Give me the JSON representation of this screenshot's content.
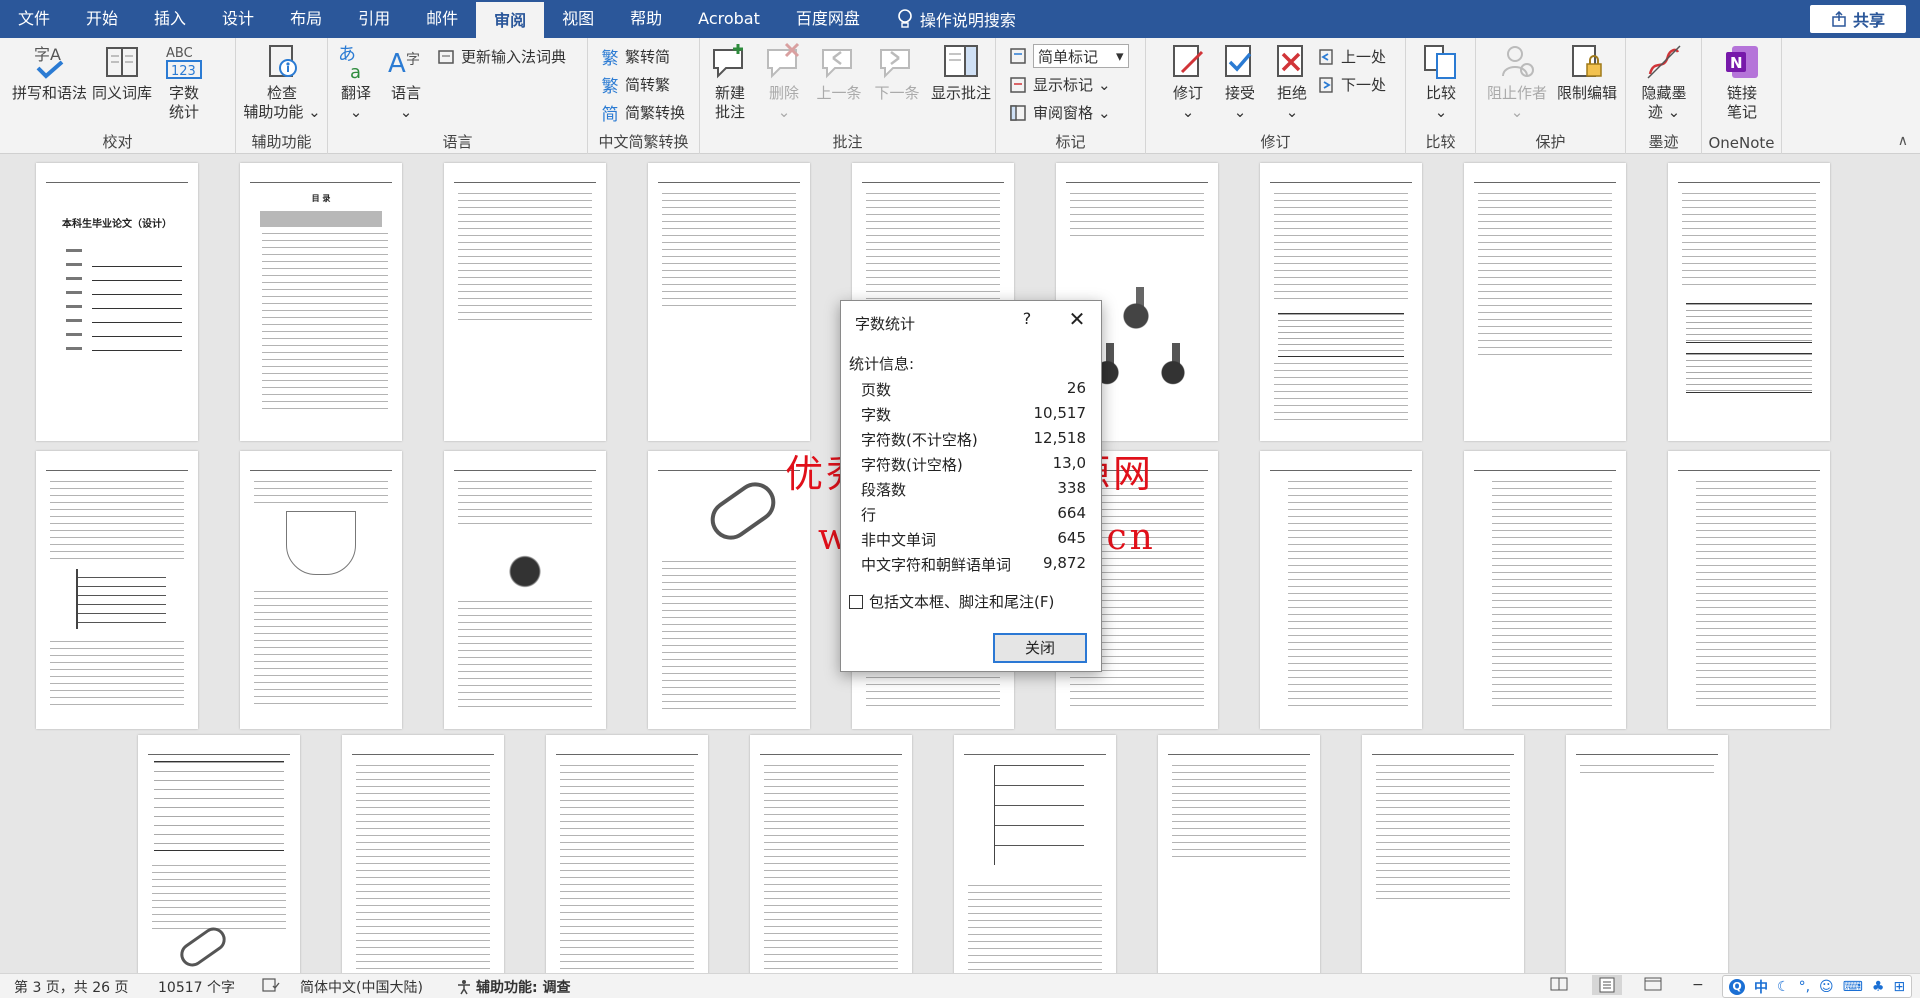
{
  "menubar": {
    "tabs": [
      "文件",
      "开始",
      "插入",
      "设计",
      "布局",
      "引用",
      "邮件",
      "审阅",
      "视图",
      "帮助",
      "Acrobat",
      "百度网盘"
    ],
    "active_tab": "审阅",
    "tell_me": "操作说明搜索",
    "share": "共享"
  },
  "ribbon": {
    "proofing": {
      "label": "校对",
      "spelling": "拼写和语法",
      "thesaurus": "同义词库",
      "word_count_l1": "字数",
      "word_count_l2": "统计"
    },
    "accessibility": {
      "label": "辅助功能",
      "check_l1": "检查",
      "check_l2": "辅助功能"
    },
    "language": {
      "label": "语言",
      "translate": "翻译",
      "language": "语言",
      "update_ime": "更新输入法词典"
    },
    "chinese_conversion": {
      "label": "中文简繁转换",
      "to_traditional": "繁转简",
      "to_simplified": "简转繁",
      "convert": "简繁转换"
    },
    "comments": {
      "label": "批注",
      "new_l1": "新建",
      "new_l2": "批注",
      "delete": "删除",
      "previous": "上一条",
      "next": "下一条",
      "show": "显示批注"
    },
    "tracking": {
      "label": "标记",
      "markup_dropdown": "简单标记",
      "show_markup": "显示标记",
      "reviewing_pane": "审阅窗格"
    },
    "changes": {
      "label": "修订",
      "track": "修订",
      "accept": "接受",
      "reject": "拒绝",
      "previous": "上一处",
      "next": "下一处"
    },
    "compare": {
      "label": "比较",
      "compare": "比较"
    },
    "protect": {
      "label": "保护",
      "block_authors": "阻止作者",
      "restrict_editing": "限制编辑"
    },
    "ink": {
      "label": "墨迹",
      "hide_ink_l1": "隐藏墨",
      "hide_ink_l2": "迹"
    },
    "onenote": {
      "label": "OneNote",
      "linked_l1": "链接",
      "linked_l2": "笔记"
    }
  },
  "document": {
    "page1_title": "本科生毕业论文（设计）",
    "toc_title": "目  录",
    "watermark_line1": "优秀毕业设计资源网",
    "watermark_line2": "www.hoyicad.cn"
  },
  "dialog": {
    "title": "字数统计",
    "help": "?",
    "stats_heading": "统计信息:",
    "stats": [
      {
        "label": "页数",
        "value": "26"
      },
      {
        "label": "字数",
        "value": "10,517"
      },
      {
        "label": "字符数(不计空格)",
        "value": "12,518"
      },
      {
        "label": "字符数(计空格)",
        "value": "13,0"
      },
      {
        "label": "段落数",
        "value": "338"
      },
      {
        "label": "行",
        "value": "664"
      },
      {
        "label": "非中文单词",
        "value": "645"
      },
      {
        "label": "中文字符和朝鲜语单词",
        "value": "9,872"
      }
    ],
    "include_textboxes": "包括文本框、脚注和尾注(F)",
    "close_button": "关闭"
  },
  "statusbar": {
    "page_info": "第 3 页，共 26 页",
    "word_count": "10517 个字",
    "language": "简体中文(中国大陆)",
    "accessibility": "辅助功能: 调查",
    "ime_mode": "中"
  }
}
